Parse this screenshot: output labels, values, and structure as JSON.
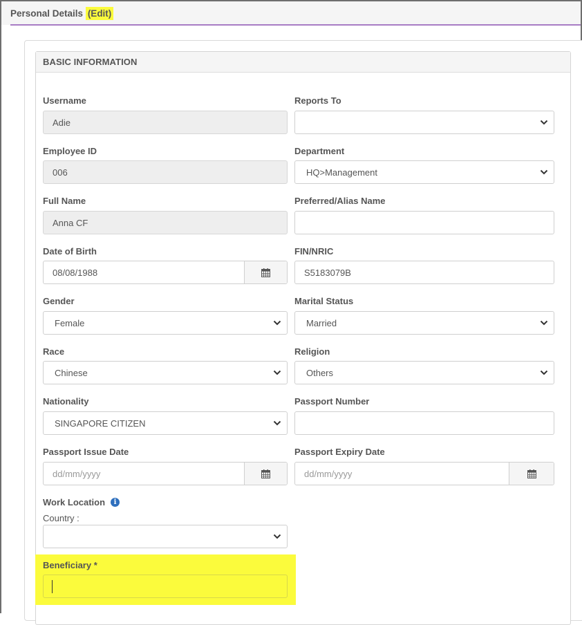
{
  "header": {
    "title": "Personal Details",
    "edit_label": "(Edit)"
  },
  "section": {
    "title": "BASIC INFORMATION"
  },
  "fields": {
    "username": {
      "label": "Username",
      "value": "Adie"
    },
    "reports_to": {
      "label": "Reports To",
      "value": ""
    },
    "employee_id": {
      "label": "Employee ID",
      "value": "006"
    },
    "department": {
      "label": "Department",
      "value": "HQ>Management"
    },
    "full_name": {
      "label": "Full Name",
      "value": "Anna CF"
    },
    "preferred_name": {
      "label": "Preferred/Alias Name",
      "value": ""
    },
    "date_of_birth": {
      "label": "Date of Birth",
      "value": "08/08/1988"
    },
    "fin_nric": {
      "label": "FIN/NRIC",
      "value": "S5183079B"
    },
    "gender": {
      "label": "Gender",
      "value": "Female"
    },
    "marital_status": {
      "label": "Marital Status",
      "value": "Married"
    },
    "race": {
      "label": "Race",
      "value": "Chinese"
    },
    "religion": {
      "label": "Religion",
      "value": "Others"
    },
    "nationality": {
      "label": "Nationality",
      "value": "SINGAPORE CITIZEN"
    },
    "passport_number": {
      "label": "Passport Number",
      "value": ""
    },
    "passport_issue_date": {
      "label": "Passport Issue Date",
      "placeholder": "dd/mm/yyyy"
    },
    "passport_expiry_date": {
      "label": "Passport Expiry Date",
      "placeholder": "dd/mm/yyyy"
    },
    "work_location": {
      "label": "Work Location",
      "country_label": "Country :",
      "value": ""
    },
    "beneficiary": {
      "label": "Beneficiary *",
      "value": ""
    }
  },
  "icons": {
    "calendar": "calendar-icon",
    "chevron": "chevron-down-icon",
    "info": "info-icon"
  },
  "colors": {
    "highlight": "#fbfb3c",
    "header_line": "#a77bc4",
    "info_icon": "#2e6fbd",
    "readonly_bg": "#eeeeee"
  }
}
